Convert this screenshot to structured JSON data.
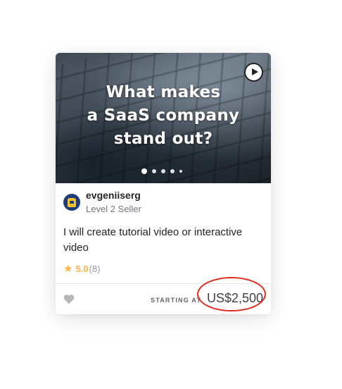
{
  "gig": {
    "media": {
      "lines": [
        "What makes",
        "a SaaS company",
        "stand out?"
      ],
      "play_icon": "play-icon",
      "slide_count": 5,
      "active_slide": 1
    },
    "seller": {
      "name": "evgeniiserg",
      "level": "Level 2 Seller",
      "avatar": "avatar-icon"
    },
    "title": "I will create tutorial video or interactive video",
    "rating": {
      "icon": "star-icon",
      "score": "5.0",
      "count": "(8)"
    },
    "footer": {
      "favorite_icon": "heart-icon",
      "starting_label": "STARTING AT",
      "price": "US$2,500"
    }
  },
  "colors": {
    "star": "#ffb33e",
    "highlight": "#e02a1c",
    "text": "#222325",
    "muted": "#74767e"
  }
}
